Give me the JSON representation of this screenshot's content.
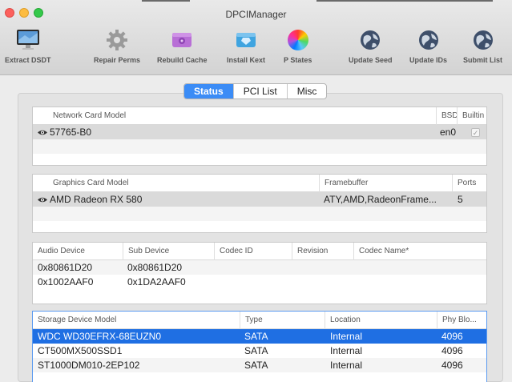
{
  "window": {
    "title": "DPCIManager"
  },
  "toolbar": {
    "items": [
      {
        "label": "Extract DSDT",
        "icon": "monitor-icon"
      },
      {
        "label": "Repair Perms",
        "icon": "gear-icon"
      },
      {
        "label": "Rebuild Cache",
        "icon": "drive-icon"
      },
      {
        "label": "Install Kext",
        "icon": "kext-icon"
      },
      {
        "label": "P States",
        "icon": "color-wheel-icon"
      },
      {
        "label": "Update Seed",
        "icon": "globe-icon"
      },
      {
        "label": "Update IDs",
        "icon": "globe-icon"
      },
      {
        "label": "Submit List",
        "icon": "globe-icon"
      }
    ]
  },
  "tabs": [
    {
      "label": "Status",
      "active": true
    },
    {
      "label": "PCI List",
      "active": false
    },
    {
      "label": "Misc",
      "active": false
    }
  ],
  "network": {
    "headers": [
      "Network Card Model",
      "BSD",
      "Builtin"
    ],
    "rows": [
      {
        "model": "57765-B0",
        "bsd": "en0",
        "builtin": "✓"
      }
    ]
  },
  "graphics": {
    "headers": [
      "Graphics Card Model",
      "Framebuffer",
      "Ports"
    ],
    "rows": [
      {
        "model": "AMD Radeon RX 580",
        "framebuffer": "ATY,AMD,RadeonFrame...",
        "ports": "5"
      }
    ]
  },
  "audio": {
    "headers": [
      "Audio Device",
      "Sub Device",
      "Codec ID",
      "Revision",
      "Codec Name*"
    ],
    "rows": [
      {
        "device": "0x80861D20",
        "sub": "0x80861D20"
      },
      {
        "device": "0x1002AAF0",
        "sub": "0x1DA2AAF0"
      }
    ]
  },
  "storage": {
    "headers": [
      "Storage Device Model",
      "Type",
      "Location",
      "Phy Blo..."
    ],
    "rows": [
      {
        "model": "WDC WD30EFRX-68EUZN0",
        "type": "SATA",
        "location": "Internal",
        "block": "4096"
      },
      {
        "model": "CT500MX500SSD1",
        "type": "SATA",
        "location": "Internal",
        "block": "4096"
      },
      {
        "model": "ST1000DM010-2EP102",
        "type": "SATA",
        "location": "Internal",
        "block": "4096"
      }
    ]
  }
}
